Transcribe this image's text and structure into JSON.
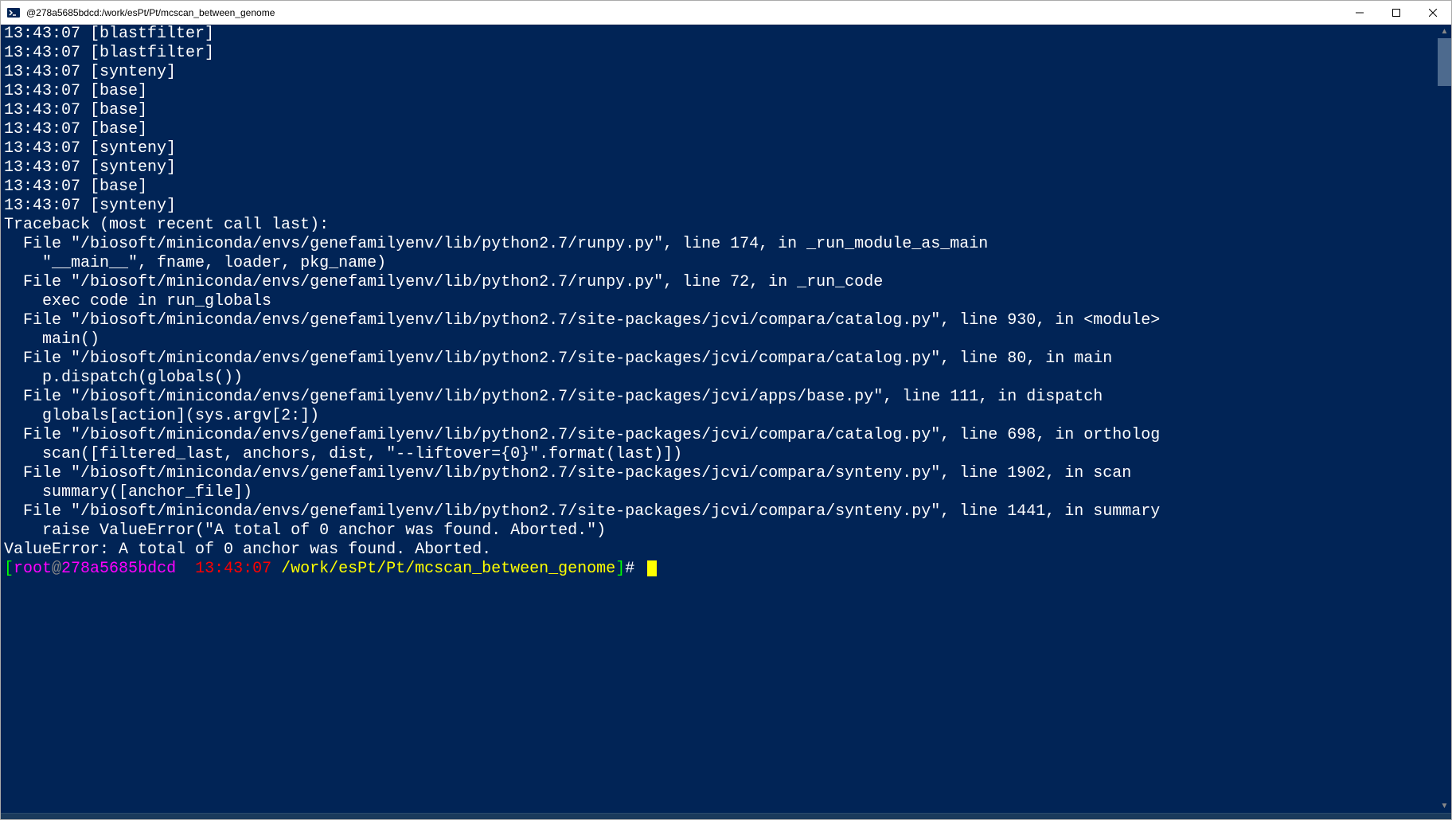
{
  "window": {
    "title": "@278a5685bdcd:/work/esPt/Pt/mcscan_between_genome"
  },
  "terminal": {
    "lines": [
      "13:43:07 [blastfilter]",
      "13:43:07 [blastfilter]",
      "13:43:07 [synteny]",
      "13:43:07 [base]",
      "13:43:07 [base]",
      "13:43:07 [base]",
      "13:43:07 [synteny]",
      "13:43:07 [synteny]",
      "13:43:07 [base]",
      "13:43:07 [synteny]",
      "Traceback (most recent call last):",
      "  File \"/biosoft/miniconda/envs/genefamilyenv/lib/python2.7/runpy.py\", line 174, in _run_module_as_main",
      "    \"__main__\", fname, loader, pkg_name)",
      "  File \"/biosoft/miniconda/envs/genefamilyenv/lib/python2.7/runpy.py\", line 72, in _run_code",
      "    exec code in run_globals",
      "  File \"/biosoft/miniconda/envs/genefamilyenv/lib/python2.7/site-packages/jcvi/compara/catalog.py\", line 930, in <module>",
      "    main()",
      "  File \"/biosoft/miniconda/envs/genefamilyenv/lib/python2.7/site-packages/jcvi/compara/catalog.py\", line 80, in main",
      "    p.dispatch(globals())",
      "  File \"/biosoft/miniconda/envs/genefamilyenv/lib/python2.7/site-packages/jcvi/apps/base.py\", line 111, in dispatch",
      "    globals[action](sys.argv[2:])",
      "  File \"/biosoft/miniconda/envs/genefamilyenv/lib/python2.7/site-packages/jcvi/compara/catalog.py\", line 698, in ortholog",
      "    scan([filtered_last, anchors, dist, \"--liftover={0}\".format(last)])",
      "  File \"/biosoft/miniconda/envs/genefamilyenv/lib/python2.7/site-packages/jcvi/compara/synteny.py\", line 1902, in scan",
      "    summary([anchor_file])",
      "  File \"/biosoft/miniconda/envs/genefamilyenv/lib/python2.7/site-packages/jcvi/compara/synteny.py\", line 1441, in summary",
      "    raise ValueError(\"A total of 0 anchor was found. Aborted.\")",
      "ValueError: A total of 0 anchor was found. Aborted."
    ],
    "prompt": {
      "bracket_open": "[",
      "user": "root",
      "at": "@",
      "host": "278a5685bdcd",
      "time": "  13:43:07 ",
      "path": "/work/esPt/Pt/mcscan_between_genome",
      "bracket_close": "]",
      "symbol": "# "
    }
  }
}
